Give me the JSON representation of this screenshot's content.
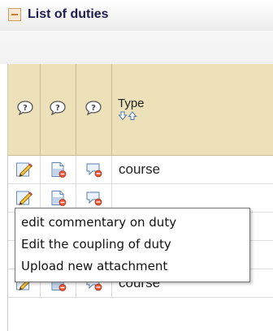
{
  "panel": {
    "title": "List of duties"
  },
  "table": {
    "type_header": "Type",
    "rows": [
      {
        "type": "course"
      },
      {
        "type": ""
      },
      {
        "type": ""
      },
      {
        "type": ""
      },
      {
        "type": "course"
      }
    ]
  },
  "tooltip": {
    "items": [
      "edit commentary on duty",
      "Edit the coupling of duty",
      "Upload new attachment"
    ]
  },
  "colors": {
    "header_bg": "#ece1b9",
    "title_text": "#1e1e50",
    "collapse_accent": "#d07a2a"
  },
  "icons": {
    "collapse": "minus-icon",
    "column_help": "help-bubble-icon",
    "sort": "sort-arrows-icon",
    "edit": "pencil-edit-icon",
    "document": "document-icon",
    "comment": "comment-bubble-icon"
  }
}
